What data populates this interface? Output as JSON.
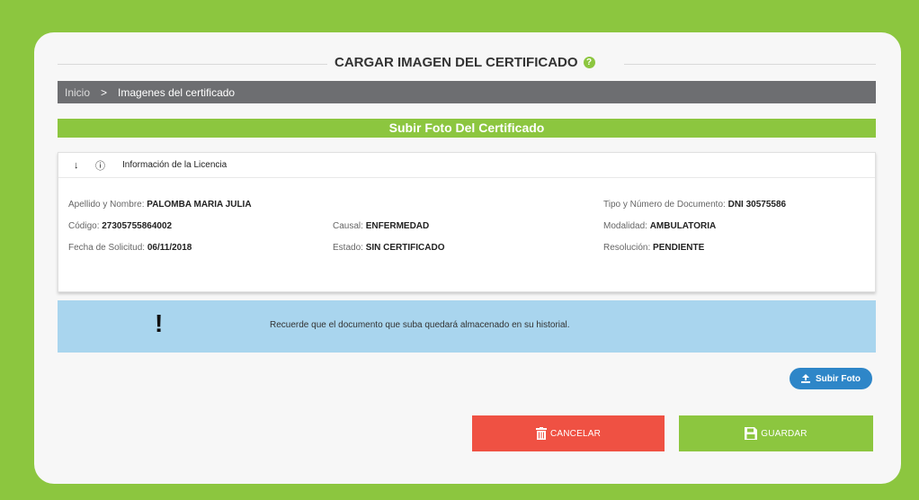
{
  "header": {
    "title": "CARGAR IMAGEN DEL CERTIFICADO",
    "help_icon": "question-circle-icon"
  },
  "breadcrumb": {
    "home": "Inicio",
    "separator": ">",
    "current": "Imagenes del certificado"
  },
  "section": {
    "title": "Subir Foto Del Certificado"
  },
  "panel": {
    "title": "Información de la Licencia",
    "arrow_icon": "arrow-down-icon",
    "info_icon": "info-icon",
    "fields": {
      "nombre_label": "Apellido y Nombre:",
      "nombre_value": "PALOMBA MARIA JULIA",
      "documento_label": "Tipo y Número de Documento:",
      "documento_value": "DNI 30575586",
      "codigo_label": "Código:",
      "codigo_value": "27305755864002",
      "causal_label": "Causal:",
      "causal_value": "ENFERMEDAD",
      "modalidad_label": "Modalidad:",
      "modalidad_value": "AMBULATORIA",
      "fecha_label": "Fecha de Solicitud:",
      "fecha_value": "06/11/2018",
      "estado_label": "Estado:",
      "estado_value": "SIN CERTIFICADO",
      "resolucion_label": "Resolución:",
      "resolucion_value": "PENDIENTE"
    }
  },
  "notice": {
    "icon": "!",
    "text": "Recuerde que el documento que suba quedará almacenado en su historial."
  },
  "actions": {
    "upload_label": "Subir Foto",
    "cancel_label": "CANCELAR",
    "save_label": "GUARDAR"
  },
  "colors": {
    "brand_green": "#8cc63f",
    "breadcrumb_gray": "#6d6e71",
    "cancel_red": "#ef5143",
    "upload_blue": "#2e86c8",
    "notice_blue": "#a9d5ee"
  }
}
